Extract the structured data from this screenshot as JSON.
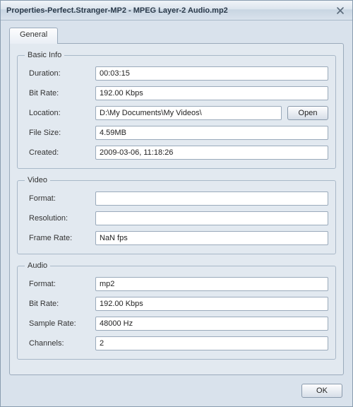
{
  "window": {
    "title": "Properties-Perfect.Stranger-MP2 - MPEG Layer-2 Audio.mp2"
  },
  "tabs": {
    "general": "General"
  },
  "groups": {
    "basic": {
      "legend": "Basic Info",
      "duration_label": "Duration:",
      "duration_value": "00:03:15",
      "bitrate_label": "Bit Rate:",
      "bitrate_value": "192.00 Kbps",
      "location_label": "Location:",
      "location_value": "D:\\My Documents\\My Videos\\",
      "open_label": "Open",
      "filesize_label": "File Size:",
      "filesize_value": "4.59MB",
      "created_label": "Created:",
      "created_value": "2009-03-06, 11:18:26"
    },
    "video": {
      "legend": "Video",
      "format_label": "Format:",
      "format_value": "",
      "resolution_label": "Resolution:",
      "resolution_value": "",
      "framerate_label": "Frame Rate:",
      "framerate_value": "NaN fps"
    },
    "audio": {
      "legend": "Audio",
      "format_label": "Format:",
      "format_value": "mp2",
      "bitrate_label": "Bit Rate:",
      "bitrate_value": "192.00 Kbps",
      "samplerate_label": "Sample Rate:",
      "samplerate_value": "48000 Hz",
      "channels_label": "Channels:",
      "channels_value": "2"
    }
  },
  "footer": {
    "ok_label": "OK"
  }
}
